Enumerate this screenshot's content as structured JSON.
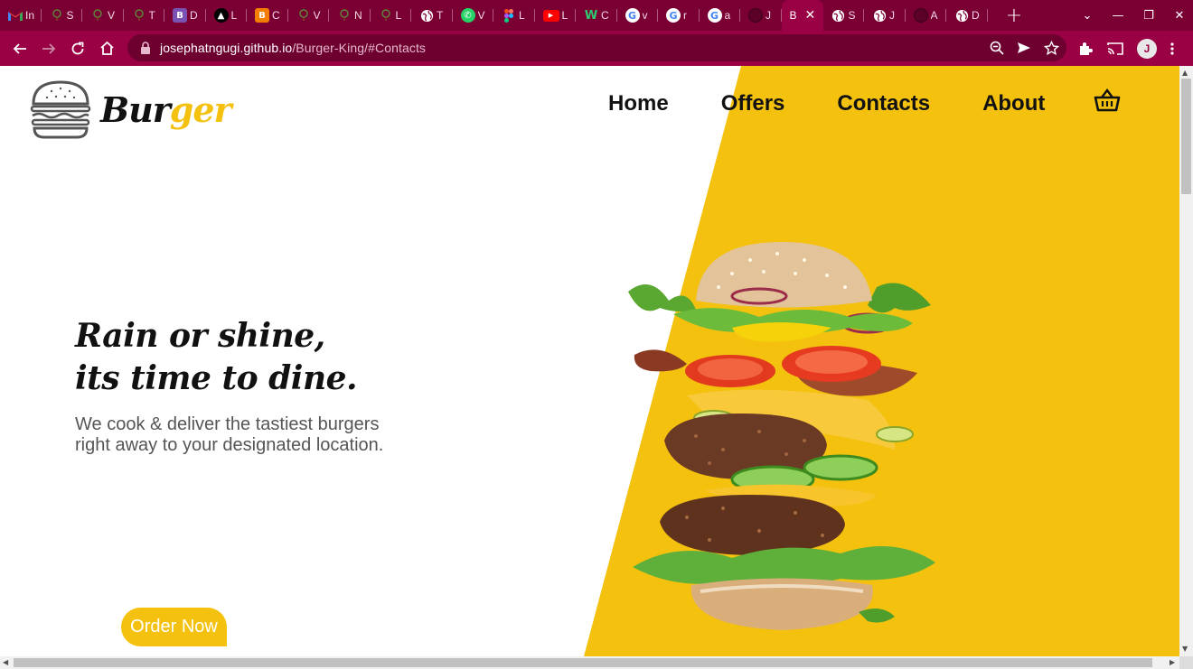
{
  "browser": {
    "tabs": [
      {
        "icon": "gmail-icon",
        "label": "In",
        "color": "#ffffff"
      },
      {
        "icon": "tree-icon",
        "label": "S",
        "color": "#7a0033"
      },
      {
        "icon": "tree-icon",
        "label": "V",
        "color": "#7a0033"
      },
      {
        "icon": "tree-icon",
        "label": "T",
        "color": "#7a0033"
      },
      {
        "icon": "bootstrap-icon",
        "label": "D",
        "color": "#7952b3"
      },
      {
        "icon": "graduation-cap-icon",
        "label": "L",
        "color": "#000000"
      },
      {
        "icon": "blogger-icon",
        "label": "C",
        "color": "#f57d00"
      },
      {
        "icon": "tree-icon",
        "label": "V",
        "color": "#7a0033"
      },
      {
        "icon": "tree-icon",
        "label": "N",
        "color": "#7a0033"
      },
      {
        "icon": "tree-icon",
        "label": "L",
        "color": "#7a0033"
      },
      {
        "icon": "globe-icon",
        "label": "T",
        "color": "#7a0033"
      },
      {
        "icon": "whatsapp-icon",
        "label": "V",
        "color": "#25d366"
      },
      {
        "icon": "figma-icon",
        "label": "L",
        "color": "#7a0033"
      },
      {
        "icon": "youtube-icon",
        "label": "L",
        "color": "#ff0000"
      },
      {
        "icon": "w-icon",
        "label": "C",
        "color": "#7a0033"
      },
      {
        "icon": "google-icon",
        "label": "v",
        "color": "#ffffff"
      },
      {
        "icon": "google-icon",
        "label": "r",
        "color": "#ffffff"
      },
      {
        "icon": "google-icon",
        "label": "a",
        "color": "#ffffff"
      },
      {
        "icon": "github-icon",
        "label": "J",
        "color": "#7a0033"
      },
      {
        "icon": "none",
        "label": "B",
        "color": "#9a0044",
        "active": true
      },
      {
        "icon": "globe-icon",
        "label": "S",
        "color": "#7a0033"
      },
      {
        "icon": "globe-icon",
        "label": "J",
        "color": "#7a0033"
      },
      {
        "icon": "github-icon",
        "label": "A",
        "color": "#7a0033"
      },
      {
        "icon": "globe-icon",
        "label": "D",
        "color": "#7a0033"
      }
    ],
    "new_tab_icon": "plus-icon",
    "url_host": "josephatngugi.github.io",
    "url_path": "/Burger-King/#Contacts",
    "profile_initial": "J",
    "chrome_color": "#9a0044"
  },
  "site": {
    "logo_part1": "Bur",
    "logo_part2": "ger",
    "nav": {
      "home": "Home",
      "offers": "Offers",
      "contacts": "Contacts",
      "about": "About"
    },
    "cart_icon": "basket-icon",
    "hero_line1": "Rain or shine,",
    "hero_line2": "its time to dine.",
    "hero_sub": "We cook & deliver the tastiest burgers right away to your designated location.",
    "order_button": "Order Now",
    "accent_color": "#f4c10f"
  }
}
